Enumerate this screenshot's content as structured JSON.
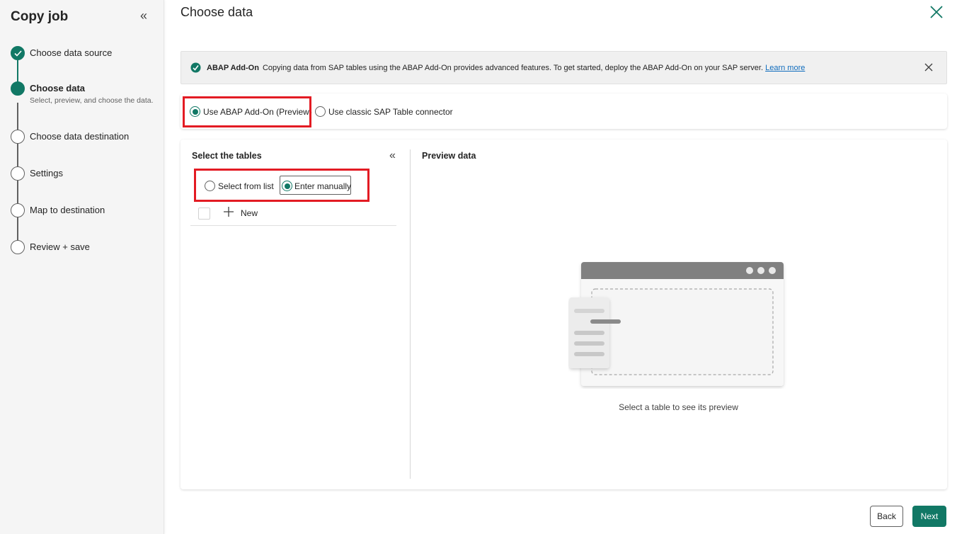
{
  "sidebar": {
    "title": "Copy job",
    "steps": [
      {
        "label": "Choose data source",
        "state": "done"
      },
      {
        "label": "Choose data",
        "sublabel": "Select, preview, and choose the data.",
        "state": "active"
      },
      {
        "label": "Choose data destination",
        "state": "pending"
      },
      {
        "label": "Settings",
        "state": "pending"
      },
      {
        "label": "Map to destination",
        "state": "pending"
      },
      {
        "label": "Review + save",
        "state": "pending"
      }
    ]
  },
  "main": {
    "title": "Choose data"
  },
  "infobar": {
    "title": "ABAP Add-On",
    "message": "Copying data from SAP tables using the ABAP Add-On provides advanced features. To get started, deploy the ABAP Add-On on your SAP server.",
    "link": "Learn more"
  },
  "connector_options": {
    "abap": "Use ABAP Add-On (Preview)",
    "classic": "Use classic SAP Table connector",
    "selected": "abap"
  },
  "tables": {
    "title": "Select the tables",
    "mode_list": "Select from list",
    "mode_manual": "Enter manually",
    "selected_mode": "manual",
    "new_label": "New"
  },
  "preview": {
    "title": "Preview data",
    "hint": "Select a table to see its preview"
  },
  "footer": {
    "back": "Back",
    "next": "Next"
  },
  "colors": {
    "accent": "#117865",
    "highlight": "#e31b23",
    "link": "#0f6cbd"
  }
}
